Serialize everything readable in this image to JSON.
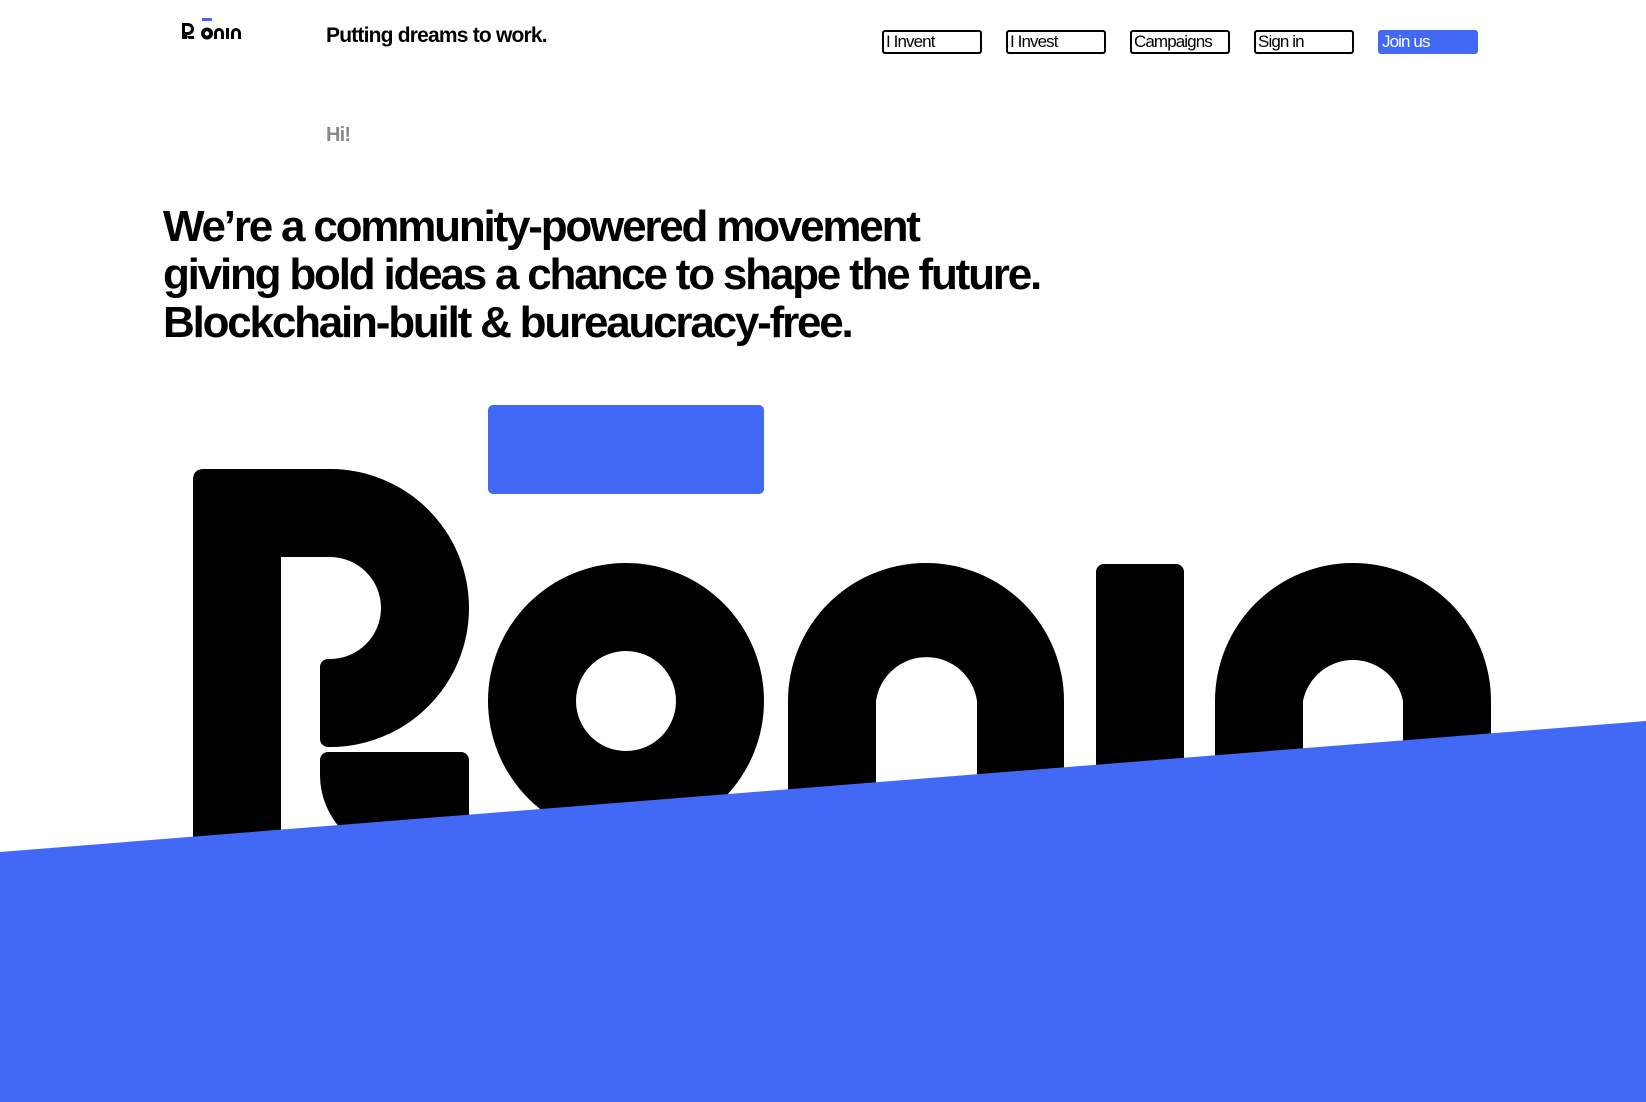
{
  "header": {
    "logo": "Ronin",
    "tagline": "Putting dreams to work."
  },
  "nav": {
    "invent": "I Invent",
    "invest": "I Invest",
    "campaigns": "Campaigns",
    "sign_in": "Sign in",
    "join": "Join us"
  },
  "hero": {
    "greeting": "Hi!",
    "headline": [
      "We’re a community-powered movement",
      "giving bold ideas a chance to shape the future.",
      "Blockchain-built & bureaucracy-free."
    ],
    "brand_wordmark": "Ronin"
  },
  "colors": {
    "brand_blue": "#4169f6",
    "text": "#000000",
    "muted": "#8a8a8a",
    "background": "#ffffff"
  }
}
